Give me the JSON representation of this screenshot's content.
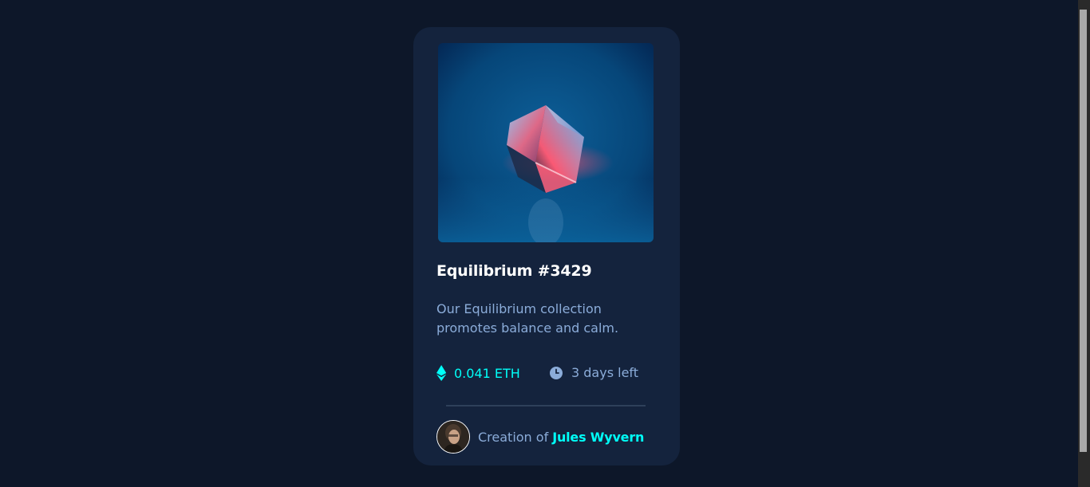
{
  "card": {
    "title": "Equilibrium #3429",
    "description": "Our Equilibrium collection promotes balance and calm.",
    "price": "0.041 ETH",
    "time_left": "3 days left",
    "creator_prefix": "Creation of",
    "creator_name": "Jules Wyvern"
  },
  "icons": {
    "price": "ethereum-icon",
    "time": "clock-icon"
  },
  "colors": {
    "page_background": "#0d1729",
    "card_background": "#14233d",
    "accent_cyan": "#00fff8",
    "soft_blue": "#8bacd9",
    "divider": "#2e405a",
    "white": "#ffffff"
  }
}
